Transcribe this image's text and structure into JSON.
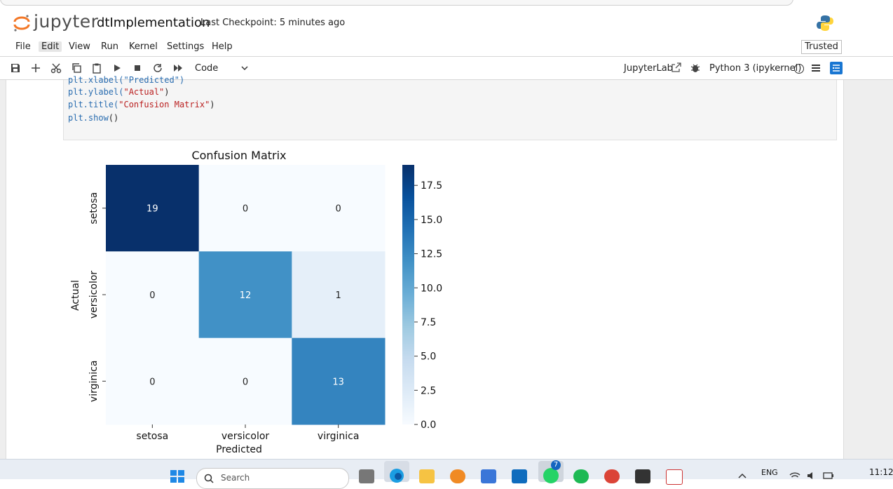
{
  "header": {
    "logo_text": "jupyter",
    "notebook_title": "dtImplementation",
    "checkpoint": "Last Checkpoint: 5 minutes ago"
  },
  "menu": {
    "items": [
      "File",
      "Edit",
      "View",
      "Run",
      "Kernel",
      "Settings",
      "Help"
    ],
    "active": "Edit",
    "trusted": "Trusted"
  },
  "toolbar": {
    "cell_type": "Code",
    "jupyterlab": "JupyterLab",
    "kernel": "Python 3 (ipykernel)"
  },
  "code": {
    "line0": "plt.xlabel(\"Predicted\")",
    "line1_fn": "plt.ylabel(",
    "line1_str": "\"Actual\"",
    "line1_end": ")",
    "line2_fn": "plt.title(",
    "line2_str": "\"Confusion Matrix\"",
    "line2_end": ")",
    "line3_fn": "plt.show",
    "line3_end": "()"
  },
  "chart_data": {
    "type": "heatmap",
    "title": "Confusion Matrix",
    "xlabel": "Predicted",
    "ylabel": "Actual",
    "x_categories": [
      "setosa",
      "versicolor",
      "virginica"
    ],
    "y_categories": [
      "setosa",
      "versicolor",
      "virginica"
    ],
    "values": [
      [
        19,
        0,
        0
      ],
      [
        0,
        12,
        1
      ],
      [
        0,
        0,
        13
      ]
    ],
    "colormap": "Blues",
    "colorbar_range": [
      0,
      19
    ],
    "colorbar_ticks": [
      "0.0",
      "2.5",
      "5.0",
      "7.5",
      "10.0",
      "12.5",
      "15.0",
      "17.5"
    ],
    "colorbar_tick_values": [
      0,
      2.5,
      5,
      7.5,
      10,
      12.5,
      15,
      17.5
    ],
    "cell_colors": [
      [
        "#08306b",
        "#f7fbff",
        "#f7fbff"
      ],
      [
        "#f7fbff",
        "#4191c6",
        "#e5eff9"
      ],
      [
        "#f7fbff",
        "#f7fbff",
        "#3484bf"
      ]
    ]
  },
  "taskbar": {
    "search_placeholder": "Search",
    "lang": "ENG",
    "time": "11:12",
    "badge": "7"
  }
}
